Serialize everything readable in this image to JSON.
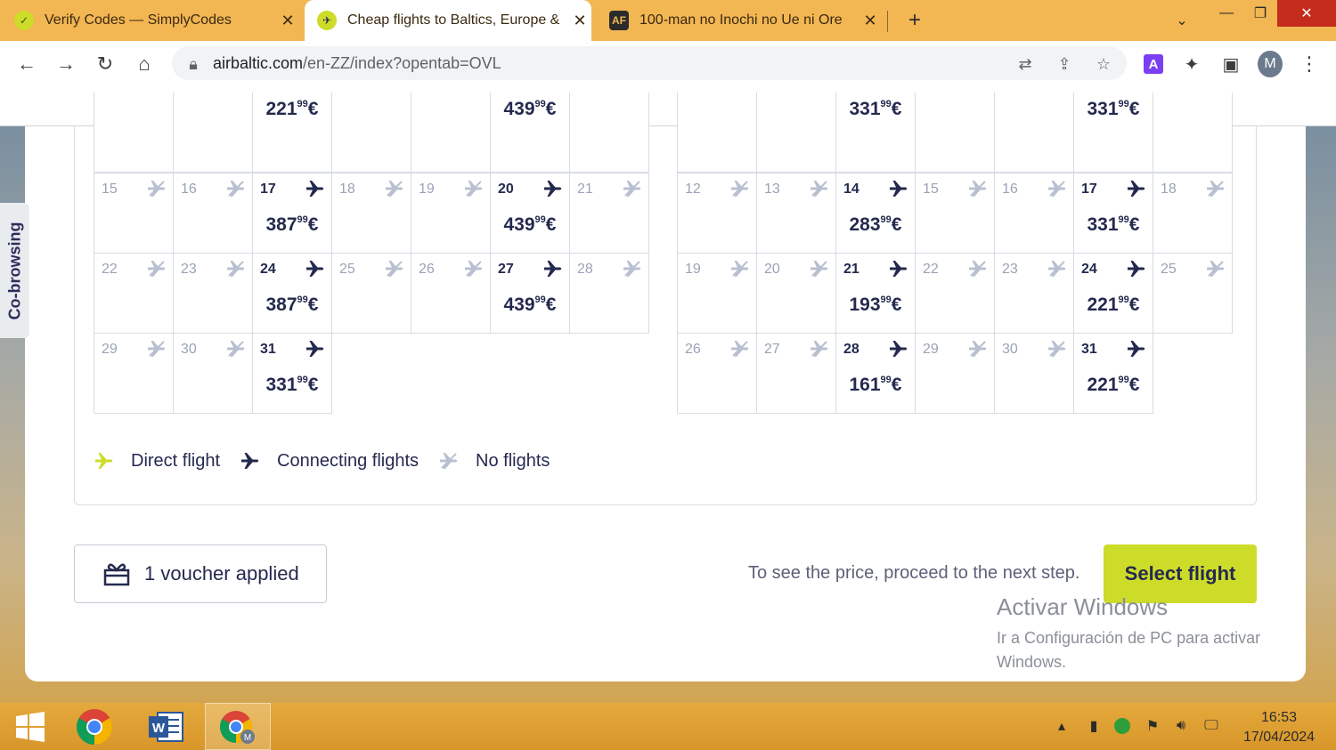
{
  "browser": {
    "tabs": [
      {
        "title": "Verify Codes — SimplyCodes",
        "active": false
      },
      {
        "title": "Cheap flights to Baltics, Europe &",
        "active": true
      },
      {
        "title": "100-man no Inochi no Ue ni Ore",
        "active": false
      }
    ],
    "url_host": "airbaltic.com",
    "url_path": "/en-ZZ/index?opentab=OVL",
    "profile_initial": "M"
  },
  "sidebar": {
    "cobrowsing_label": "Co-browsing"
  },
  "calendar_left": {
    "cells": [
      {
        "day": "",
        "price_main": "",
        "price_cents": "",
        "status": "none"
      },
      {
        "day": "",
        "price_main": "",
        "price_cents": "",
        "status": "none"
      },
      {
        "day": "",
        "price_main": "221",
        "price_cents": "99",
        "price_currency": "€",
        "status": "connecting"
      },
      {
        "day": "",
        "price_main": "",
        "price_cents": "",
        "status": "none"
      },
      {
        "day": "",
        "price_main": "",
        "price_cents": "",
        "status": "none"
      },
      {
        "day": "",
        "price_main": "439",
        "price_cents": "99",
        "price_currency": "€",
        "status": "connecting"
      },
      {
        "day": "",
        "price_main": "",
        "price_cents": "",
        "status": "none"
      },
      {
        "day": "15",
        "status": "none"
      },
      {
        "day": "16",
        "status": "none"
      },
      {
        "day": "17",
        "price_main": "387",
        "price_cents": "99",
        "price_currency": "€",
        "status": "connecting"
      },
      {
        "day": "18",
        "status": "none"
      },
      {
        "day": "19",
        "status": "none"
      },
      {
        "day": "20",
        "price_main": "439",
        "price_cents": "99",
        "price_currency": "€",
        "status": "connecting"
      },
      {
        "day": "21",
        "status": "none"
      },
      {
        "day": "22",
        "status": "none"
      },
      {
        "day": "23",
        "status": "none"
      },
      {
        "day": "24",
        "price_main": "387",
        "price_cents": "99",
        "price_currency": "€",
        "status": "connecting"
      },
      {
        "day": "25",
        "status": "none"
      },
      {
        "day": "26",
        "status": "none"
      },
      {
        "day": "27",
        "price_main": "439",
        "price_cents": "99",
        "price_currency": "€",
        "status": "connecting"
      },
      {
        "day": "28",
        "status": "none"
      },
      {
        "day": "29",
        "status": "none"
      },
      {
        "day": "30",
        "status": "none"
      },
      {
        "day": "31",
        "price_main": "331",
        "price_cents": "99",
        "price_currency": "€",
        "status": "connecting"
      }
    ]
  },
  "calendar_right": {
    "cells": [
      {
        "day": "",
        "status": "none"
      },
      {
        "day": "",
        "status": "none"
      },
      {
        "day": "",
        "price_main": "331",
        "price_cents": "99",
        "price_currency": "€",
        "status": "connecting"
      },
      {
        "day": "",
        "status": "none"
      },
      {
        "day": "",
        "status": "none"
      },
      {
        "day": "",
        "price_main": "331",
        "price_cents": "99",
        "price_currency": "€",
        "status": "connecting"
      },
      {
        "day": "",
        "status": "none"
      },
      {
        "day": "12",
        "status": "none"
      },
      {
        "day": "13",
        "status": "none"
      },
      {
        "day": "14",
        "price_main": "283",
        "price_cents": "99",
        "price_currency": "€",
        "status": "connecting"
      },
      {
        "day": "15",
        "status": "none"
      },
      {
        "day": "16",
        "status": "none"
      },
      {
        "day": "17",
        "price_main": "331",
        "price_cents": "99",
        "price_currency": "€",
        "status": "connecting"
      },
      {
        "day": "18",
        "status": "none"
      },
      {
        "day": "19",
        "status": "none"
      },
      {
        "day": "20",
        "status": "none"
      },
      {
        "day": "21",
        "price_main": "193",
        "price_cents": "99",
        "price_currency": "€",
        "status": "connecting"
      },
      {
        "day": "22",
        "status": "none"
      },
      {
        "day": "23",
        "status": "none"
      },
      {
        "day": "24",
        "price_main": "221",
        "price_cents": "99",
        "price_currency": "€",
        "status": "connecting"
      },
      {
        "day": "25",
        "status": "none"
      },
      {
        "day": "26",
        "status": "none"
      },
      {
        "day": "27",
        "status": "none"
      },
      {
        "day": "28",
        "price_main": "161",
        "price_cents": "99",
        "price_currency": "€",
        "status": "connecting"
      },
      {
        "day": "29",
        "status": "none"
      },
      {
        "day": "30",
        "status": "none"
      },
      {
        "day": "31",
        "price_main": "221",
        "price_cents": "99",
        "price_currency": "€",
        "status": "connecting"
      }
    ]
  },
  "legend": {
    "direct": "Direct flight",
    "connecting": "Connecting flights",
    "none": "No flights"
  },
  "footer": {
    "voucher_label": "1 voucher applied",
    "hint": "To see the price, proceed to the next step.",
    "select_button": "Select flight"
  },
  "watermark": {
    "title": "Activar Windows",
    "subtitle": "Ir a Configuración de PC para activar Windows."
  },
  "taskbar": {
    "time": "16:53",
    "date": "17/04/2024"
  },
  "colors": {
    "accent": "#cddc29",
    "navy": "#242a4e",
    "muted": "#9aa3b5",
    "tabbar": "#f2b653"
  }
}
